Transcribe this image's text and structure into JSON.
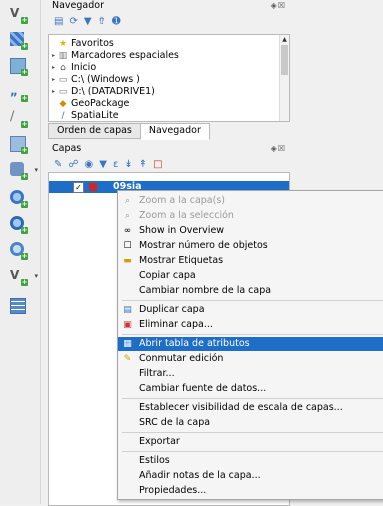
{
  "browser_panel": {
    "title": "Navegador",
    "controls": "◈☒"
  },
  "browser_tree": [
    {
      "label": "Favoritos",
      "icon": "star-icon",
      "glyph": "★",
      "color": "#e8b400",
      "caret": ""
    },
    {
      "label": "Marcadores espaciales",
      "icon": "bookmark-icon",
      "glyph": "▥",
      "color": "#777777",
      "caret": "▸"
    },
    {
      "label": "Inicio",
      "icon": "home-folder-icon",
      "glyph": "⌂",
      "color": "#555555",
      "caret": "▸"
    },
    {
      "label": "C:\\ (Windows )",
      "icon": "folder-icon",
      "glyph": "▭",
      "color": "#777777",
      "caret": "▸"
    },
    {
      "label": "D:\\ (DATADRIVE1)",
      "icon": "folder-icon",
      "glyph": "▭",
      "color": "#777777",
      "caret": "▸"
    },
    {
      "label": "GeoPackage",
      "icon": "geopackage-icon",
      "glyph": "◆",
      "color": "#d28a00",
      "caret": ""
    },
    {
      "label": "SpatiaLite",
      "icon": "spatialite-icon",
      "glyph": "∕",
      "color": "#3a6fb0",
      "caret": ""
    }
  ],
  "tabs": {
    "layer_order": "Orden de capas",
    "browser": "Navegador"
  },
  "layers_panel": {
    "title": "Capas",
    "controls": "◈☒"
  },
  "layer": {
    "name": "09sia",
    "checked": "✓",
    "color": "#cc2828"
  },
  "context_menu": [
    {
      "label": "Zoom a la capa(s)",
      "icon": "zoom-to-layer-icon",
      "glyph": "⌕",
      "state": "disabled"
    },
    {
      "label": "Zoom a la selección",
      "icon": "zoom-to-selection-icon",
      "glyph": "⌕",
      "state": "disabled"
    },
    {
      "label": "Show in Overview",
      "icon": "overview-icon",
      "glyph": "∞",
      "state": "normal"
    },
    {
      "label": "Mostrar número de objetos",
      "icon": "feature-count-checkbox",
      "glyph": "☐",
      "state": "normal"
    },
    {
      "label": "Mostrar Etiquetas",
      "icon": "labels-icon",
      "glyph": "▬",
      "state": "normal"
    },
    {
      "label": "Copiar capa",
      "icon": "",
      "glyph": "",
      "state": "normal"
    },
    {
      "label": "Cambiar nombre de la capa",
      "icon": "",
      "glyph": "",
      "state": "normal",
      "sep_after": true
    },
    {
      "label": "Duplicar capa",
      "icon": "duplicate-layer-icon",
      "glyph": "▤",
      "state": "normal"
    },
    {
      "label": "Eliminar capa...",
      "icon": "remove-layer-icon",
      "glyph": "▣",
      "state": "normal",
      "sep_after": true
    },
    {
      "label": "Abrir tabla de atributos",
      "icon": "attribute-table-icon",
      "glyph": "▦",
      "state": "highlighted"
    },
    {
      "label": "Conmutar edición",
      "icon": "toggle-editing-icon",
      "glyph": "✎",
      "state": "normal"
    },
    {
      "label": "Filtrar...",
      "icon": "",
      "glyph": "",
      "state": "normal"
    },
    {
      "label": "Cambiar fuente de datos...",
      "icon": "",
      "glyph": "",
      "state": "normal",
      "sep_after": true
    },
    {
      "label": "Establecer visibilidad de escala de capas...",
      "icon": "",
      "glyph": "",
      "state": "normal"
    },
    {
      "label": "SRC de la capa",
      "icon": "",
      "glyph": "",
      "state": "normal",
      "submenu": "▸",
      "sep_after": true
    },
    {
      "label": "Exportar",
      "icon": "",
      "glyph": "",
      "state": "normal",
      "submenu": "▸",
      "sep_after": true
    },
    {
      "label": "Estilos",
      "icon": "",
      "glyph": "",
      "state": "normal",
      "submenu": "▸"
    },
    {
      "label": "Añadir notas de la capa...",
      "icon": "",
      "glyph": "",
      "state": "normal"
    },
    {
      "label": "Propiedades...",
      "icon": "",
      "glyph": "",
      "state": "normal"
    }
  ],
  "colors": {
    "highlight": "#1e6ec8",
    "plus_badge": "#3fa33f"
  }
}
